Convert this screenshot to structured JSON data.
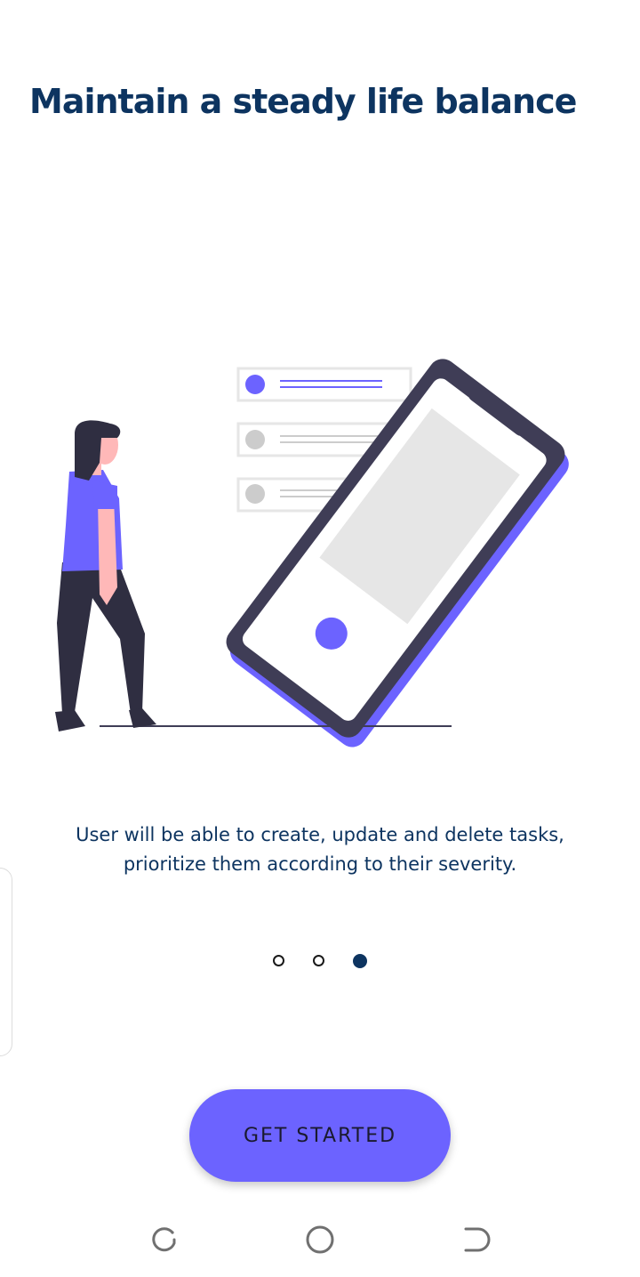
{
  "onboarding": {
    "title": "Maintain a steady life balance",
    "description": "User will be able to create, update and delete tasks, prioritize them according to their severity.",
    "page_indicator": {
      "total": 3,
      "current": 3
    },
    "cta_label": "GET STARTED"
  },
  "illustration": {
    "icon": "woman-with-phone-task-list-illustration",
    "accent_color": "#6c63ff",
    "dark_color": "#3f3d56",
    "inactive_color": "#cccccc"
  },
  "navigation_bar": {
    "items": [
      {
        "icon": "recent-apps-icon"
      },
      {
        "icon": "home-icon"
      },
      {
        "icon": "back-icon"
      }
    ]
  },
  "colors": {
    "title": "#0d3460",
    "button": "#6c63ff",
    "active_dot": "#0d3460"
  }
}
